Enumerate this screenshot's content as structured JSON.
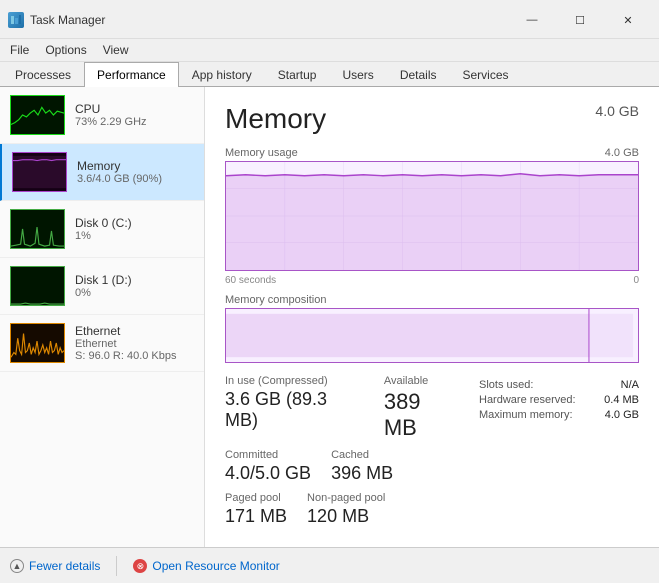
{
  "titleBar": {
    "icon": "task-manager-icon",
    "title": "Task Manager",
    "minimizeLabel": "—",
    "maximizeLabel": "☐",
    "closeLabel": "✕"
  },
  "menuBar": {
    "items": [
      "File",
      "Options",
      "View"
    ]
  },
  "tabs": [
    {
      "id": "processes",
      "label": "Processes",
      "active": false
    },
    {
      "id": "performance",
      "label": "Performance",
      "active": true
    },
    {
      "id": "app-history",
      "label": "App history",
      "active": false
    },
    {
      "id": "startup",
      "label": "Startup",
      "active": false
    },
    {
      "id": "users",
      "label": "Users",
      "active": false
    },
    {
      "id": "details",
      "label": "Details",
      "active": false
    },
    {
      "id": "services",
      "label": "Services",
      "active": false
    }
  ],
  "sidebar": {
    "items": [
      {
        "id": "cpu",
        "title": "CPU",
        "subtitle": "73% 2.29 GHz",
        "graphColor": "#1adc1a",
        "bgColor": "#001500",
        "active": false
      },
      {
        "id": "memory",
        "title": "Memory",
        "subtitle": "3.6/4.0 GB (90%)",
        "graphColor": "#aa44cc",
        "bgColor": "#150015",
        "active": true
      },
      {
        "id": "disk0",
        "title": "Disk 0 (C:)",
        "subtitle": "1%",
        "graphColor": "#44aa44",
        "bgColor": "#001500",
        "active": false
      },
      {
        "id": "disk1",
        "title": "Disk 1 (D:)",
        "subtitle": "0%",
        "graphColor": "#44aa44",
        "bgColor": "#001500",
        "active": false
      },
      {
        "id": "ethernet",
        "title": "Ethernet",
        "subtitle": "Ethernet",
        "subtitle2": "S: 96.0  R: 40.0 Kbps",
        "graphColor": "#dd8800",
        "bgColor": "#150a00",
        "active": false
      }
    ]
  },
  "content": {
    "title": "Memory",
    "totalMemory": "4.0 GB",
    "charts": {
      "usageLabel": "Memory usage",
      "usageMax": "4.0 GB",
      "timeStart": "60 seconds",
      "timeEnd": "0",
      "compositionLabel": "Memory composition"
    },
    "stats": {
      "inUseLabel": "In use (Compressed)",
      "inUseValue": "3.6 GB (89.3 MB)",
      "availableLabel": "Available",
      "availableValue": "389 MB",
      "committedLabel": "Committed",
      "committedValue": "4.0/5.0 GB",
      "cachedLabel": "Cached",
      "cachedValue": "396 MB",
      "pagedPoolLabel": "Paged pool",
      "pagedPoolValue": "171 MB",
      "nonPagedPoolLabel": "Non-paged pool",
      "nonPagedPoolValue": "120 MB"
    },
    "statsRight": {
      "slotsUsedLabel": "Slots used:",
      "slotsUsedValue": "N/A",
      "hardwareReservedLabel": "Hardware reserved:",
      "hardwareReservedValue": "0.4 MB",
      "maxMemoryLabel": "Maximum memory:",
      "maxMemoryValue": "4.0 GB"
    }
  },
  "bottomBar": {
    "fewerDetailsLabel": "Fewer details",
    "openResourceMonitorLabel": "Open Resource Monitor"
  }
}
